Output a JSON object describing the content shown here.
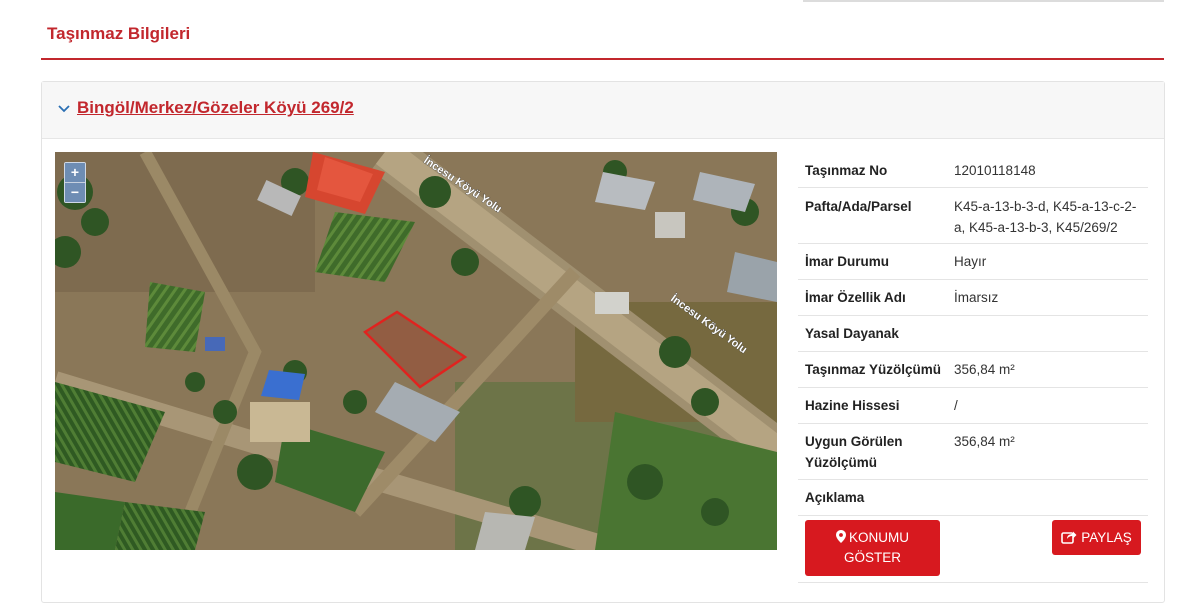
{
  "section": {
    "title": "Taşınmaz Bilgileri"
  },
  "panel": {
    "link_text": "Bingöl/Merkez/Gözeler Köyü 269/2"
  },
  "map": {
    "zoom_in": "+",
    "zoom_out": "−",
    "road_label_1": "İncesu Köyü Yolu",
    "road_label_2": "İncesu Köyü Yolu",
    "parcel_color": "#e0231f"
  },
  "details": {
    "rows": [
      {
        "label": "Taşınmaz No",
        "value": "12010118148"
      },
      {
        "label": "Pafta/Ada/Parsel",
        "value": "K45-a-13-b-3-d, K45-a-13-c-2-a, K45-a-13-b-3, K45/269/2"
      },
      {
        "label": "İmar Durumu",
        "value": "Hayır"
      },
      {
        "label": "İmar Özellik Adı",
        "value": "İmarsız"
      },
      {
        "label": "Yasal Dayanak",
        "value": ""
      },
      {
        "label": "Taşınmaz Yüzölçümü",
        "value": "356,84 m²"
      },
      {
        "label": "Hazine Hissesi",
        "value": "/"
      },
      {
        "label": "Uygun Görülen Yüzölçümü",
        "value": "356,84 m²"
      },
      {
        "label": "Açıklama",
        "value": ""
      }
    ]
  },
  "actions": {
    "show_location_line1": "KONUMU",
    "show_location_line2": "GÖSTER",
    "share": "PAYLAŞ",
    "accent_color": "#d7191f"
  }
}
